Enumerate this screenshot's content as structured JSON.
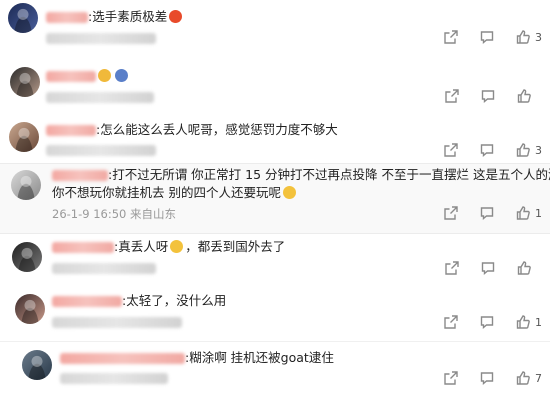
{
  "comments": [
    {
      "text": ":选手素质极差",
      "time": "",
      "likes": "3"
    },
    {
      "text": "",
      "time": "",
      "likes": ""
    },
    {
      "text": ":怎么能这么丢人呢哥，感觉惩罚力度不够大",
      "time": "",
      "likes": "3"
    },
    {
      "text": ":打不过无所谓 你正常打 15 分钟打不过再点投降 不至于一直摆烂 这是五个人的游戏",
      "text2": "你不想玩你就挂机去 别的四个人还要玩呢",
      "time": "26-1-9 16:50 来自山东",
      "likes": "1"
    },
    {
      "text": ":真丢人呀",
      "text2": "，都丢到国外去了",
      "time": "",
      "likes": ""
    },
    {
      "text": ":太轻了，没什么用",
      "time": "",
      "likes": "1"
    },
    {
      "text": ":糊涂啊 挂机还被goat逮住",
      "time": "",
      "likes": "7"
    }
  ],
  "icons": {
    "share": "share-icon",
    "reply": "comment-icon",
    "like": "thumbs-up-icon"
  },
  "colors": {
    "name": "#e0795f",
    "meta": "#999999",
    "icon": "#8a8a8a",
    "highlight": "#f9f9f9"
  }
}
